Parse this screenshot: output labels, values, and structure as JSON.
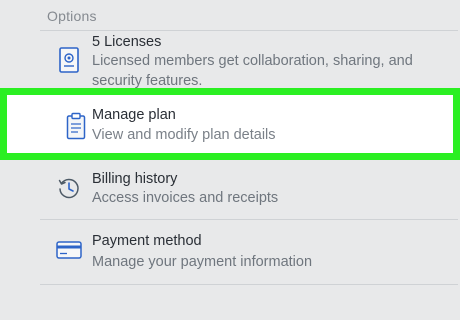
{
  "section": {
    "title": "Options"
  },
  "rows": [
    {
      "id": "licenses",
      "icon": "license-badge-icon",
      "title": "5 Licenses",
      "description": "Licensed members get collaboration, sharing, and security features."
    },
    {
      "id": "manage-plan",
      "icon": "clipboard-icon",
      "title": "Manage plan",
      "description": "View and modify plan details",
      "highlighted": true
    },
    {
      "id": "billing-history",
      "icon": "clock-history-icon",
      "title": "Billing history",
      "description": "Access invoices and receipts"
    },
    {
      "id": "payment-method",
      "icon": "credit-card-icon",
      "title": "Payment method",
      "description": "Manage your payment information"
    }
  ],
  "colors": {
    "background": "#e8e9ea",
    "highlight_border": "#2bef22",
    "icon_accent": "#2d64c8",
    "title_text": "#2a2f36",
    "description_text": "#6f767e"
  }
}
